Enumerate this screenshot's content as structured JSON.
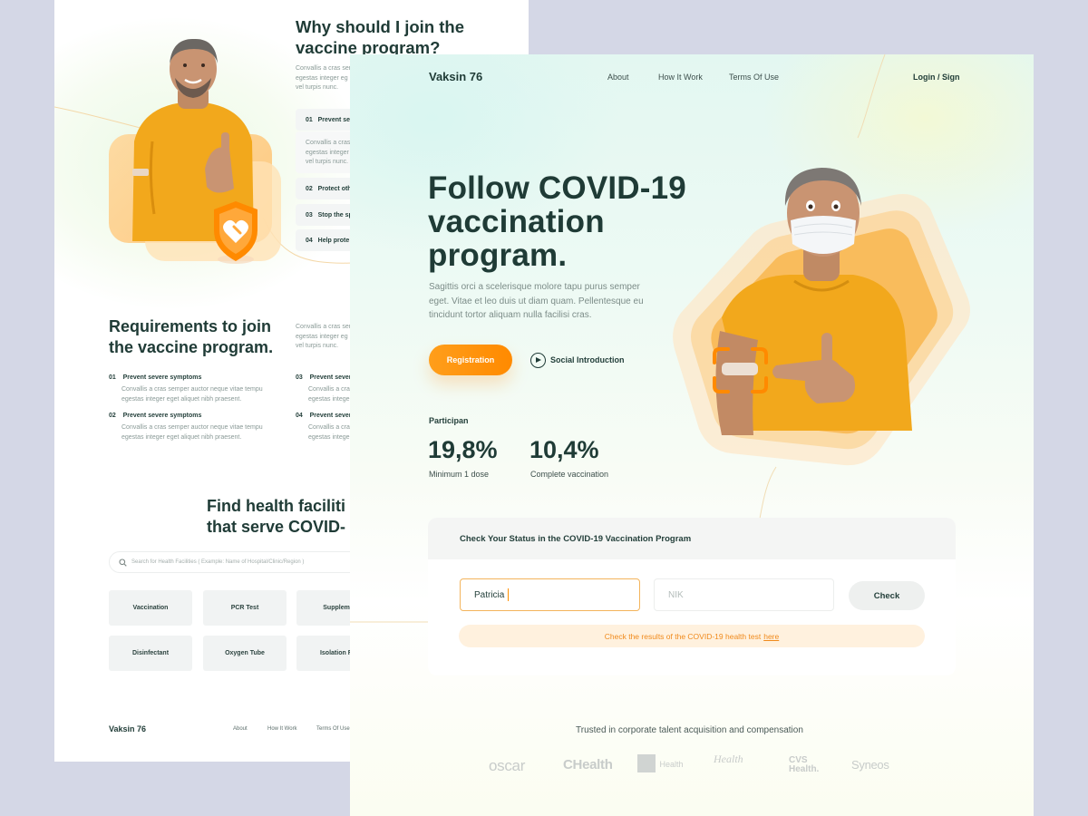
{
  "back_page": {
    "join_title": "Why should I join the\nvaccine program?",
    "join_desc": "Convallis a cras sem\negestas integer eg\nvel turpis nunc.",
    "accordion": [
      {
        "num": "01",
        "label": "Prevent sev"
      },
      {
        "num": "02",
        "label": "Protect oth"
      },
      {
        "num": "03",
        "label": "Stop the sp"
      },
      {
        "num": "04",
        "label": "Help prote"
      }
    ],
    "accordion_open_text": "Convallis a cras\negestas integer\nvel turpis nunc.",
    "req_title": "Requirements to join\nthe vaccine program.",
    "req_desc": "Convallis a cras sem\negestas integer eg\nvel turpis nunc.",
    "requirements": [
      {
        "num": "01",
        "title": "Prevent severe symptoms",
        "body": "Convallis a cras semper auctor neque vitae tempu\negestas integer eget aliquet nibh praesent."
      },
      {
        "num": "02",
        "title": "Prevent severe symptoms",
        "body": "Convallis a cras semper auctor neque vitae tempu\negestas integer eget aliquet nibh praesent."
      },
      {
        "num": "03",
        "title": "Prevent sever",
        "body": "Convallis a cras\negestas intege"
      },
      {
        "num": "04",
        "title": "Prevent sever",
        "body": "Convallis a cras\negestas intege"
      }
    ],
    "facility_title": "Find health faciliti\nthat serve COVID-",
    "search_placeholder": "Search for Health Facilities ( Example: Name of Hospital/Clinic/Region )",
    "facility_cards": [
      "Vaccination",
      "PCR Test",
      "Suppleme",
      "Disinfectant",
      "Oxygen Tube",
      "Isolation Ro"
    ],
    "footer": {
      "logo": "Vaksin 76",
      "links": [
        "About",
        "How It Work",
        "Terms Of Use"
      ]
    }
  },
  "front_page": {
    "logo": "Vaksin 76",
    "nav": [
      "About",
      "How It Work",
      "Terms Of Use"
    ],
    "login": "Login / Sign",
    "hero_title": "Follow COVID-19\nvaccination\nprogram.",
    "hero_sub": "Sagittis orci a scelerisque molore tapu purus semper eget. Vitae et leo duis ut diam quam. Pellentesque eu tincidunt tortor aliquam nulla facilisi cras.",
    "register_button": "Registration",
    "social_link": "Social Introduction",
    "participants_label": "Participan",
    "stats": [
      {
        "value": "19,8%",
        "label": "Minimum 1 dose"
      },
      {
        "value": "10,4%",
        "label": "Complete vaccination"
      }
    ],
    "status_panel": {
      "title": "Check Your Status in the COVID-19 Vaccination Program",
      "name_value": "Patricia",
      "nik_placeholder": "NIK",
      "check_button": "Check",
      "notice": "Check the results of the COVID-19 health test",
      "notice_link": "here"
    },
    "trusted_text": "Trusted in corporate talent acquisition and compensation",
    "brands": [
      "oscar",
      "CHealth",
      "Health",
      "Health",
      "CVS Health.",
      "Syneos"
    ]
  },
  "colors": {
    "accent": "#ff9100",
    "dark_text": "#1f3b36",
    "background": "#d4d7e6"
  }
}
